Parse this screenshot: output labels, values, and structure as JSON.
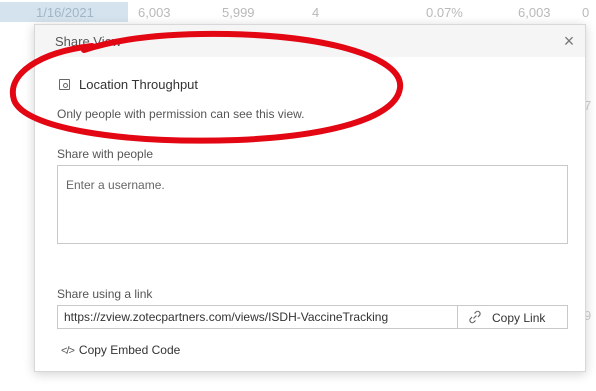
{
  "background": {
    "top_row": [
      "1/16/2021",
      "6,003",
      "5,999",
      "4",
      "0.07%",
      "6,003",
      "0"
    ],
    "side_marks": [
      "7",
      "9"
    ]
  },
  "dialog": {
    "title": "Share View",
    "close_label": "×",
    "view_name": "Location Throughput",
    "permission_note": "Only people with permission can see this view.",
    "share_people_label": "Share with people",
    "username_placeholder": "Enter a username.",
    "share_link_label": "Share using a link",
    "link_url": "https://zview.zotecpartners.com/views/ISDH-VaccineTracking",
    "copy_link_label": "Copy Link",
    "embed_icon": "</>",
    "copy_embed_label": "Copy Embed Code"
  },
  "icons": {
    "view": "view-icon",
    "link": "link-chain-icon",
    "embed": "code-icon",
    "close": "close-icon"
  },
  "colors": {
    "annotation": "#e30613",
    "header_bg": "#f5f5f5",
    "highlight_cell": "#d4e3ee"
  }
}
